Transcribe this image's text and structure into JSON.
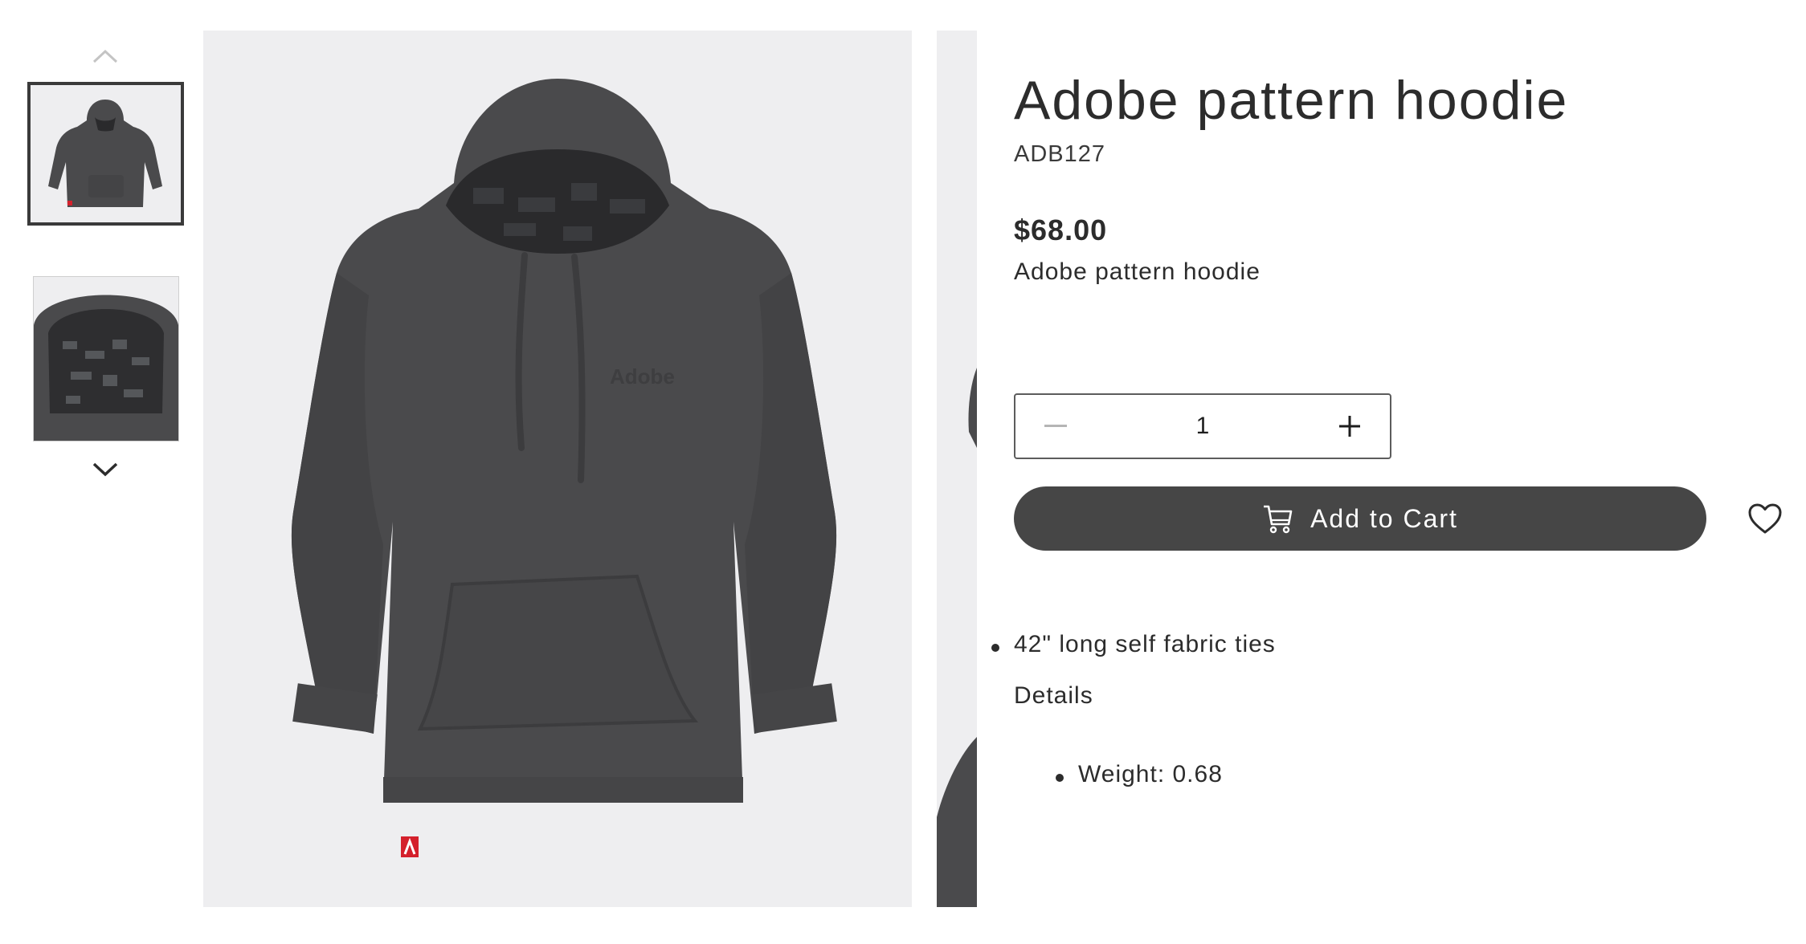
{
  "gallery": {
    "up_icon": "chevron-up-icon",
    "down_icon": "chevron-down-icon",
    "thumbnails": [
      {
        "name": "hoodie-front-thumbnail",
        "selected": true
      },
      {
        "name": "hoodie-hood-detail-thumbnail",
        "selected": false
      }
    ],
    "logo_text": "Adobe"
  },
  "product": {
    "title": "Adobe pattern hoodie",
    "sku": "ADB127",
    "price": "$68.00",
    "short_description": "Adobe pattern hoodie"
  },
  "quantity": {
    "value": "1",
    "decrement_icon": "minus-icon",
    "increment_icon": "plus-icon"
  },
  "actions": {
    "add_to_cart_label": "Add to Cart",
    "cart_icon": "cart-icon",
    "wishlist_icon": "heart-icon"
  },
  "features": [
    "42\" long self fabric ties"
  ],
  "details": {
    "heading": "Details",
    "items": [
      "Weight: 0.68"
    ]
  },
  "colors": {
    "button_bg": "#464646",
    "image_bg": "#eeeef0",
    "garment": "#4a4a4c",
    "brand_tag": "#d4202c"
  }
}
